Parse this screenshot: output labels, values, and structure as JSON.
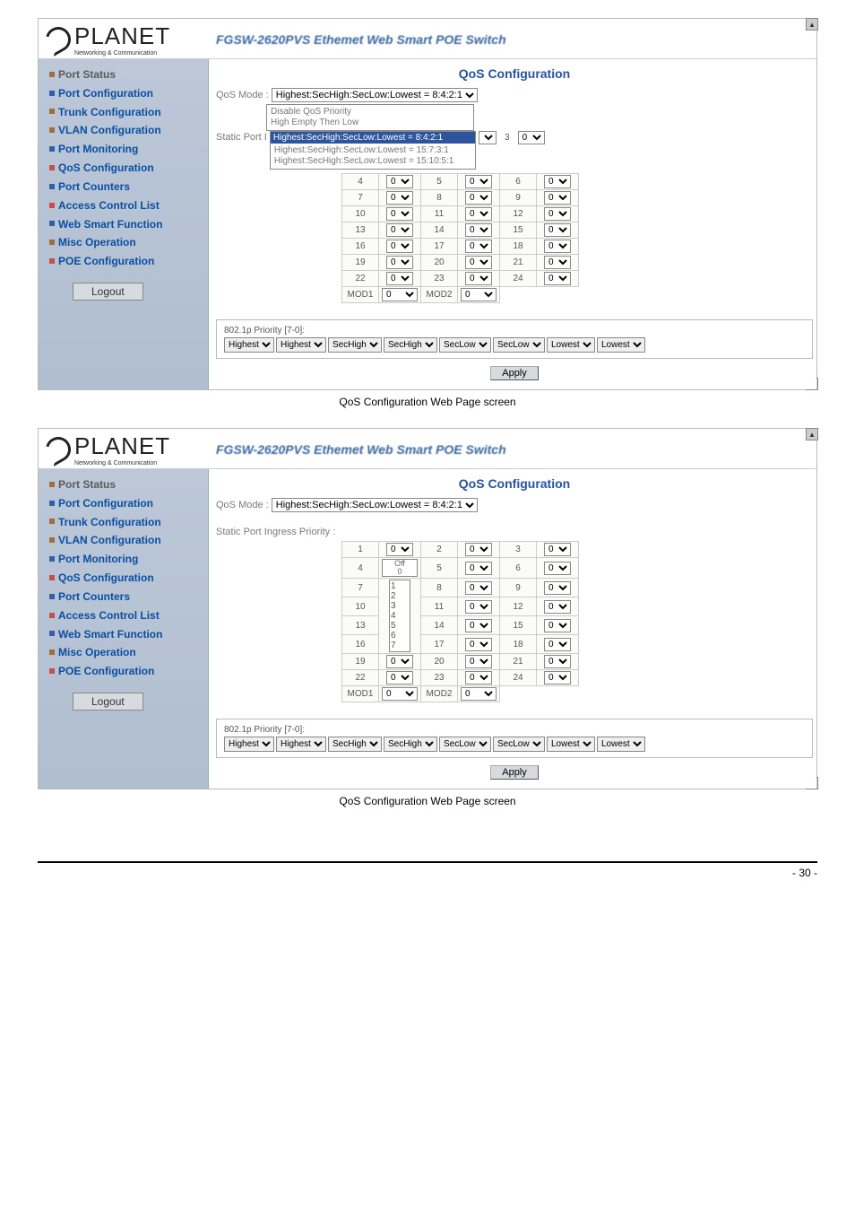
{
  "logo": {
    "name": "PLANET",
    "sub": "Networking & Communication"
  },
  "product": "FGSW-2620PVS Ethemet Web Smart POE Switch",
  "nav": [
    {
      "label": "Port Status",
      "color": "#a06d3c"
    },
    {
      "label": "Port Configuration",
      "color": "#355ea8"
    },
    {
      "label": "Trunk Configuration",
      "color": "#a06d3c"
    },
    {
      "label": "VLAN Configuration",
      "color": "#a06d3c"
    },
    {
      "label": "Port Monitoring",
      "color": "#355ea8"
    },
    {
      "label": "QoS Configuration",
      "color": "#c94d4d"
    },
    {
      "label": "Port Counters",
      "color": "#355ea8"
    },
    {
      "label": "Access Control List",
      "color": "#c94d4d"
    },
    {
      "label": "Web Smart Function",
      "color": "#355ea8"
    },
    {
      "label": "Misc Operation",
      "color": "#a06d3c"
    },
    {
      "label": "POE Configuration",
      "color": "#c94d4d"
    }
  ],
  "logout": "Logout",
  "page_title": "QoS Configuration",
  "qos_mode_label": "QoS Mode :",
  "panel1": {
    "qos_sel": "Highest:SecHigh:SecLow:Lowest = 8:4:2:1",
    "dd_options": [
      "Disable QoS Priority",
      "High Empty Then Low"
    ],
    "static_label": "Static Port I",
    "static_opts": [
      "Highest:SecHigh:SecLow:Lowest = 8:4:2:1",
      "Highest:SecHigh:SecLow:Lowest = 15:7:3:1",
      "Highest:SecHigh:SecLow:Lowest = 15:10:5:1"
    ],
    "col3_val": "3",
    "ports": [
      [
        "4",
        "5",
        "6"
      ],
      [
        "7",
        "8",
        "9"
      ],
      [
        "10",
        "11",
        "12"
      ],
      [
        "13",
        "14",
        "15"
      ],
      [
        "16",
        "17",
        "18"
      ],
      [
        "19",
        "20",
        "21"
      ],
      [
        "22",
        "23",
        "24"
      ],
      [
        "MOD1",
        "MOD2",
        ""
      ]
    ]
  },
  "panel2": {
    "qos_sel": "Highest:SecHigh:SecLow:Lowest = 8:4:2:1",
    "ingress_label": "Static Port Ingress Priority :",
    "ports": [
      [
        "1",
        "2",
        "3"
      ],
      [
        "4",
        "5",
        "6"
      ],
      [
        "7",
        "8",
        "9"
      ],
      [
        "10",
        "11",
        "12"
      ],
      [
        "13",
        "14",
        "15"
      ],
      [
        "16",
        "17",
        "18"
      ],
      [
        "19",
        "20",
        "21"
      ],
      [
        "22",
        "23",
        "24"
      ],
      [
        "MOD1",
        "MOD2",
        ""
      ]
    ],
    "side_numbers": [
      "1",
      "2",
      "3",
      "4",
      "5",
      "6",
      "7"
    ]
  },
  "prio": {
    "label": "802.1p Priority [7-0]:",
    "opts": [
      "Highest",
      "Highest",
      "SecHigh",
      "SecHigh",
      "SecLow",
      "SecLow",
      "Lowest",
      "Lowest"
    ]
  },
  "apply": "Apply",
  "caption": "QoS Configuration Web Page screen",
  "page_number": "- 30 -",
  "zero": "0",
  "off": "Off"
}
